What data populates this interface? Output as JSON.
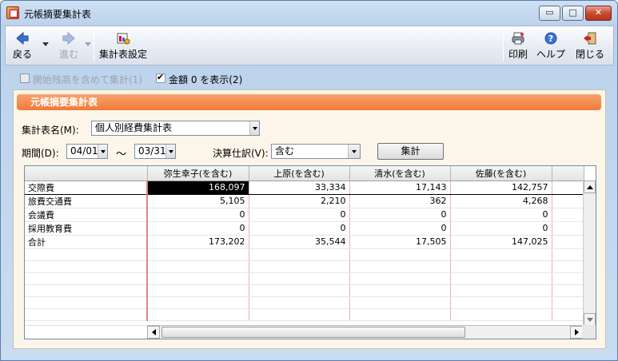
{
  "window": {
    "title": "元帳摘要集計表",
    "min_glyph": "▭",
    "max_glyph": "□",
    "close_glyph": "✕"
  },
  "toolbar": {
    "back_label": "戻る",
    "forward_label": "進む",
    "settings_label": "集計表設定",
    "print_label": "印刷",
    "help_label": "ヘルプ",
    "close_label": "閉じる"
  },
  "options": {
    "include_opening_label": "開始残高を含めて集計(1)",
    "include_opening_checked": false,
    "show_zero_label": "金額 0 を表示(2)",
    "show_zero_checked": true
  },
  "panel": {
    "header": "元帳摘要集計表",
    "report_name_label": "集計表名(M):",
    "report_name_value": "個人別経費集計表",
    "period_label": "期間(D):",
    "period_from": "04/01",
    "period_tilde": "〜",
    "period_to": "03/31",
    "closing_label": "決算仕訳(V):",
    "closing_value": "含む",
    "aggregate_button": "集計"
  },
  "grid": {
    "columns": [
      "",
      "弥生幸子(を含む)",
      "上原(を含む)",
      "清水(を含む)",
      "佐藤(を含む)",
      ""
    ],
    "rows": [
      {
        "label": "交際費",
        "values": [
          "168,097",
          "33,334",
          "17,143",
          "142,757"
        ]
      },
      {
        "label": "旅費交通費",
        "values": [
          "5,105",
          "2,210",
          "362",
          "4,268"
        ]
      },
      {
        "label": "会議費",
        "values": [
          "0",
          "0",
          "0",
          "0"
        ]
      },
      {
        "label": "採用教育費",
        "values": [
          "0",
          "0",
          "0",
          "0"
        ]
      },
      {
        "label": "合計",
        "values": [
          "173,202",
          "35,544",
          "17,505",
          "147,025"
        ]
      }
    ],
    "empty_rows": 6
  },
  "colors": {
    "panel_header": "#ef7b3a",
    "selected_cell": "#000000"
  }
}
